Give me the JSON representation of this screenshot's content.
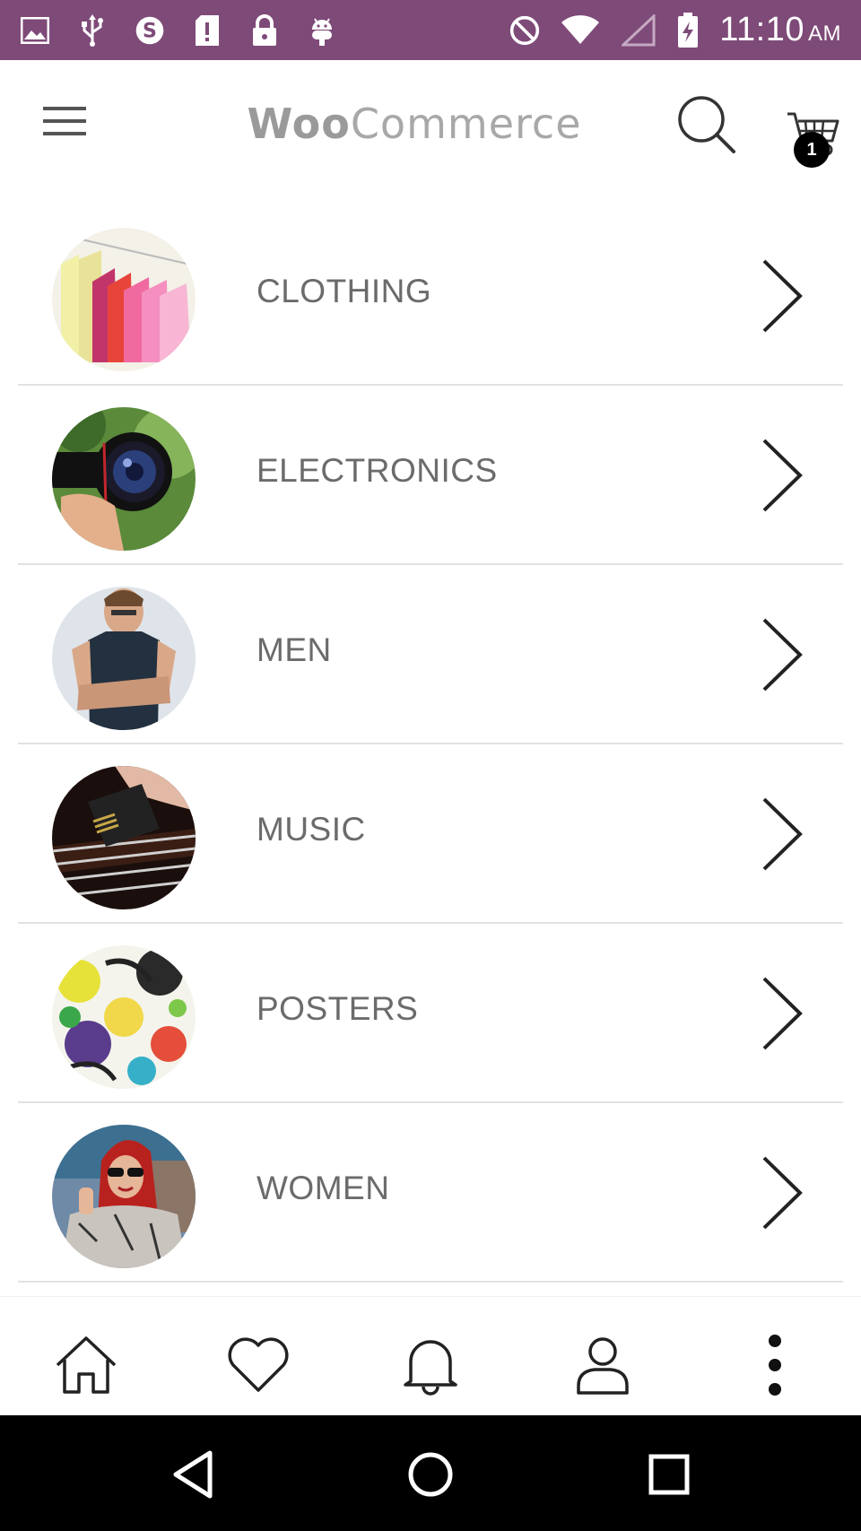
{
  "status_bar": {
    "time": "11:10",
    "ampm": "AM",
    "background": "#7e4a78",
    "left_icons": [
      "gallery-icon",
      "usb-icon",
      "skype-icon",
      "sd-card-icon",
      "lock-icon",
      "android-icon"
    ],
    "right_icons": [
      "do-not-disturb-icon",
      "wifi-icon",
      "signal-icon",
      "battery-charging-icon"
    ]
  },
  "header": {
    "logo_part1": "Woo",
    "logo_part2": "Commerce",
    "cart_count": "1"
  },
  "categories": [
    {
      "label": "CLOTHING",
      "image": "clothing-thumbnail"
    },
    {
      "label": "ELECTRONICS",
      "image": "electronics-thumbnail"
    },
    {
      "label": "MEN",
      "image": "men-thumbnail"
    },
    {
      "label": "MUSIC",
      "image": "music-thumbnail"
    },
    {
      "label": "POSTERS",
      "image": "posters-thumbnail"
    },
    {
      "label": "WOMEN",
      "image": "women-thumbnail"
    }
  ],
  "bottom_nav": [
    "home-icon",
    "heart-icon",
    "bell-icon",
    "user-icon",
    "more-vertical-icon"
  ],
  "system_nav": [
    "back-icon",
    "home-circle-icon",
    "recents-icon"
  ]
}
